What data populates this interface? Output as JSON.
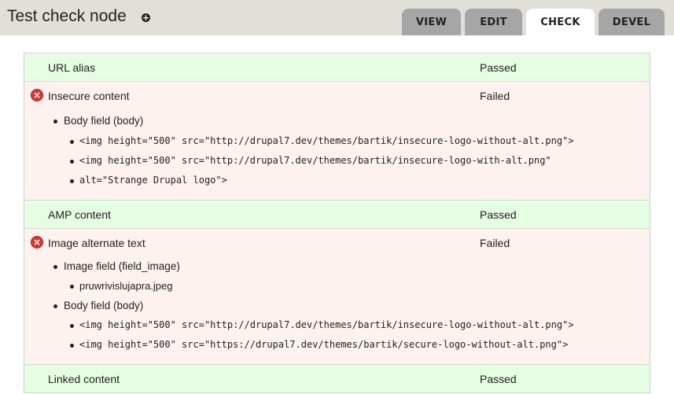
{
  "page": {
    "title": "Test check node",
    "shortcut_symbol": "+",
    "shortcut_icon": "plus-circle-icon"
  },
  "tabs": {
    "view": "VIEW",
    "edit": "EDIT",
    "check": "CHECK",
    "devel": "DEVEL",
    "active": "CHECK"
  },
  "colors": {
    "passed_bg": "#e5fde0",
    "failed_bg": "#fdf2ef",
    "error_icon": "#d63a2e"
  },
  "checks": [
    {
      "label": "URL alias",
      "status": "Passed"
    },
    {
      "label": "Insecure content",
      "status": "Failed",
      "icon": "error-icon",
      "fields": [
        {
          "name": "Body field (body)",
          "items": [
            "<img height=\"500\" src=\"http://drupal7.dev/themes/bartik/insecure-logo-without-alt.png\">",
            "<img height=\"500\" src=\"http://drupal7.dev/themes/bartik/insecure-logo-with-alt.png\"",
            "alt=\"Strange Drupal logo\">"
          ]
        }
      ]
    },
    {
      "label": "AMP content",
      "status": "Passed"
    },
    {
      "label": "Image alternate text",
      "status": "Failed",
      "icon": "error-icon",
      "fields": [
        {
          "name": "Image field (field_image)",
          "items": [
            "pruwrivislujapra.jpeg"
          ]
        },
        {
          "name": "Body field (body)",
          "items": [
            "<img height=\"500\" src=\"http://drupal7.dev/themes/bartik/insecure-logo-without-alt.png\">",
            "<img height=\"500\" src=\"https://drupal7.dev/themes/bartik/secure-logo-without-alt.png\">"
          ]
        }
      ]
    },
    {
      "label": "Linked content",
      "status": "Passed"
    }
  ]
}
